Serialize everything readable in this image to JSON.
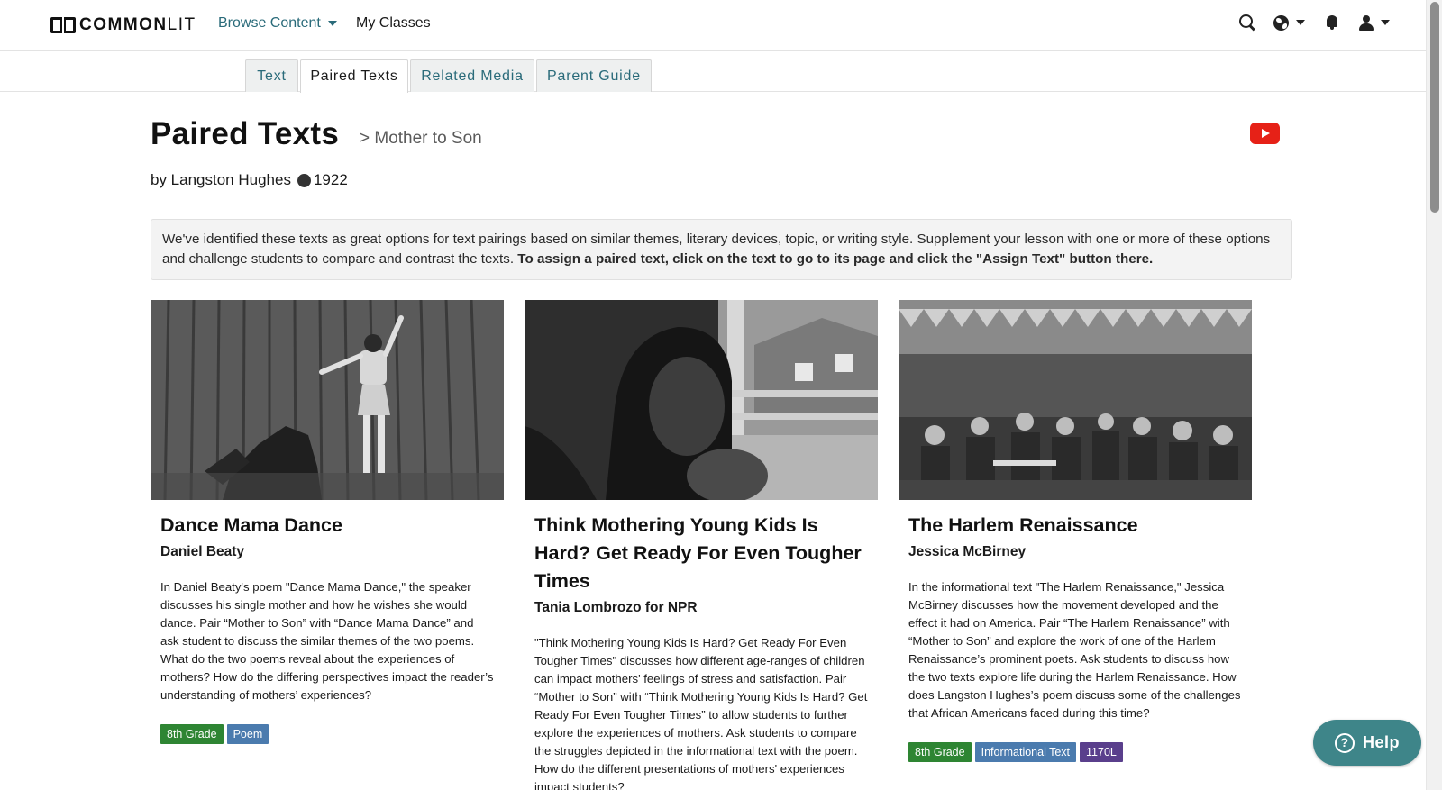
{
  "brand": {
    "logo_bold": "COMMON",
    "logo_light": "LIT"
  },
  "nav": {
    "browse": "Browse Content",
    "classes": "My Classes"
  },
  "icons": {
    "search": "search-icon",
    "globe": "globe-icon",
    "bell": "bell-icon",
    "user": "user-icon",
    "youtube": "youtube-icon",
    "help": "question-circle-icon"
  },
  "tabs": [
    {
      "label": "Text"
    },
    {
      "label": "Paired Texts"
    },
    {
      "label": "Related Media"
    },
    {
      "label": "Parent Guide"
    }
  ],
  "page": {
    "title": "Paired Texts",
    "subtitle": "> Mother to Son",
    "author": "by Langston Hughes",
    "year": "1922"
  },
  "info": {
    "text": "We've identified these texts as great options for text pairings based on similar themes, literary devices, topic, or writing style. Supplement your lesson with one or more of these options and challenge students to compare and contrast the texts.",
    "bold": "To assign a paired text, click on the text to go to its page and click the \"Assign Text\" button there."
  },
  "cards": [
    {
      "title": "Dance Mama Dance",
      "author": "Daniel Beaty",
      "description": "In Daniel Beaty's poem \"Dance Mama Dance,\" the speaker discusses his single mother and how he wishes she would dance. Pair “Mother to Son” with “Dance Mama Dance” and ask student to discuss the similar themes of the two poems. What do the two poems reveal about the experiences of mothers? How do the differing perspectives impact the reader’s understanding of mothers’ experiences?",
      "tags": [
        "8th Grade",
        "Poem"
      ]
    },
    {
      "title": "Think Mothering Young Kids Is Hard? Get Ready For Even Tougher Times",
      "author": "Tania Lombrozo for NPR",
      "description": "\"Think Mothering Young Kids Is Hard? Get Ready For Even Tougher Times\" discusses how different age-ranges of children can impact mothers' feelings of stress and satisfaction. Pair “Mother to Son” with “Think Mothering Young Kids Is Hard? Get Ready For Even Tougher Times” to allow students to further explore the experiences of mothers. Ask students to compare the struggles depicted in the informational text with the poem. How do the different presentations of mothers' experiences impact students?",
      "tags": []
    },
    {
      "title": "The Harlem Renaissance",
      "author": "Jessica McBirney",
      "description": "In the informational text \"The Harlem Renaissance,\" Jessica McBirney discusses how the movement developed and the effect it had on America. Pair “The Harlem Renaissance” with “Mother to Son” and explore the work of one of the Harlem Renaissance’s prominent poets. Ask students to discuss how the two texts explore life during the Harlem Renaissance. How does Langston Hughes’s poem discuss some of the challenges that African Americans faced during this time?",
      "tags": [
        "8th Grade",
        "Informational Text",
        "1170L"
      ]
    }
  ],
  "help": {
    "label": "Help"
  },
  "colors": {
    "brand_teal": "#2a6b7a",
    "help_bg": "#3e8589",
    "grade_tag": "#2e8533",
    "genre_tag": "#4b7bae",
    "lexile_tag": "#5a3f8c",
    "youtube_red": "#e62117"
  }
}
